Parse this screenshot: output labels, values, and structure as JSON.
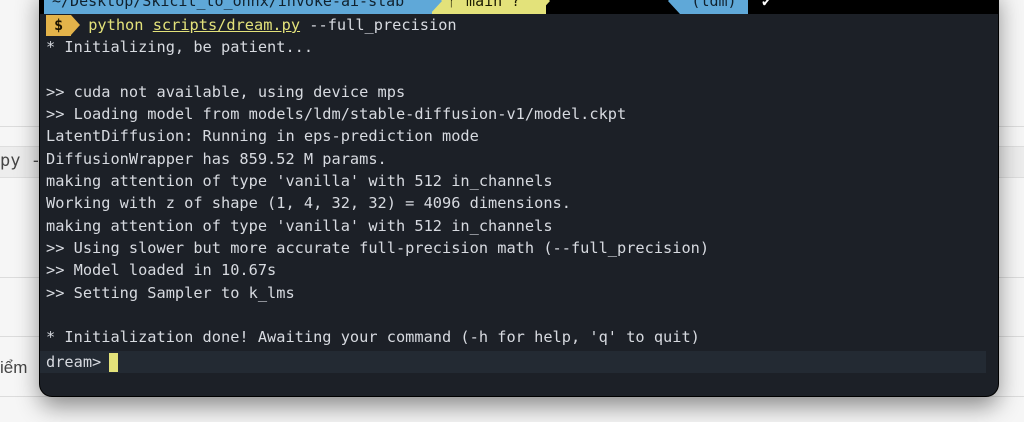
{
  "background": {
    "left_fragment_1": "py -",
    "left_fragment_2": "iểm"
  },
  "status_bar": {
    "path": "~/Desktop/Skicit_to_onnx/invoke-ai-stab",
    "git_icon": "git-branch-icon",
    "git_branch": "main ?",
    "env": "(ldm)",
    "status_check": "✔"
  },
  "terminal": {
    "prompt_symbol": "$",
    "command_program": "python",
    "command_script": "scripts/dream.py",
    "command_flag": "--full_precision",
    "output_lines": [
      "* Initializing, be patient...",
      "",
      ">> cuda not available, using device mps",
      ">> Loading model from models/ldm/stable-diffusion-v1/model.ckpt",
      "LatentDiffusion: Running in eps-prediction mode",
      "DiffusionWrapper has 859.52 M params.",
      "making attention of type 'vanilla' with 512 in_channels",
      "Working with z of shape (1, 4, 32, 32) = 4096 dimensions.",
      "making attention of type 'vanilla' with 512 in_channels",
      ">> Using slower but more accurate full-precision math (--full_precision)",
      ">> Model loaded in 10.67s",
      ">> Setting Sampler to k_lms",
      "",
      "* Initialization done! Awaiting your command (-h for help, 'q' to quit)"
    ],
    "input_prompt": "dream>"
  },
  "colors": {
    "terminal_bg": "#1c2027",
    "path_segment": "#5fa8d8",
    "git_segment": "#e3e27a",
    "prompt_badge": "#e3b34a",
    "cursor": "#e3e27a"
  }
}
